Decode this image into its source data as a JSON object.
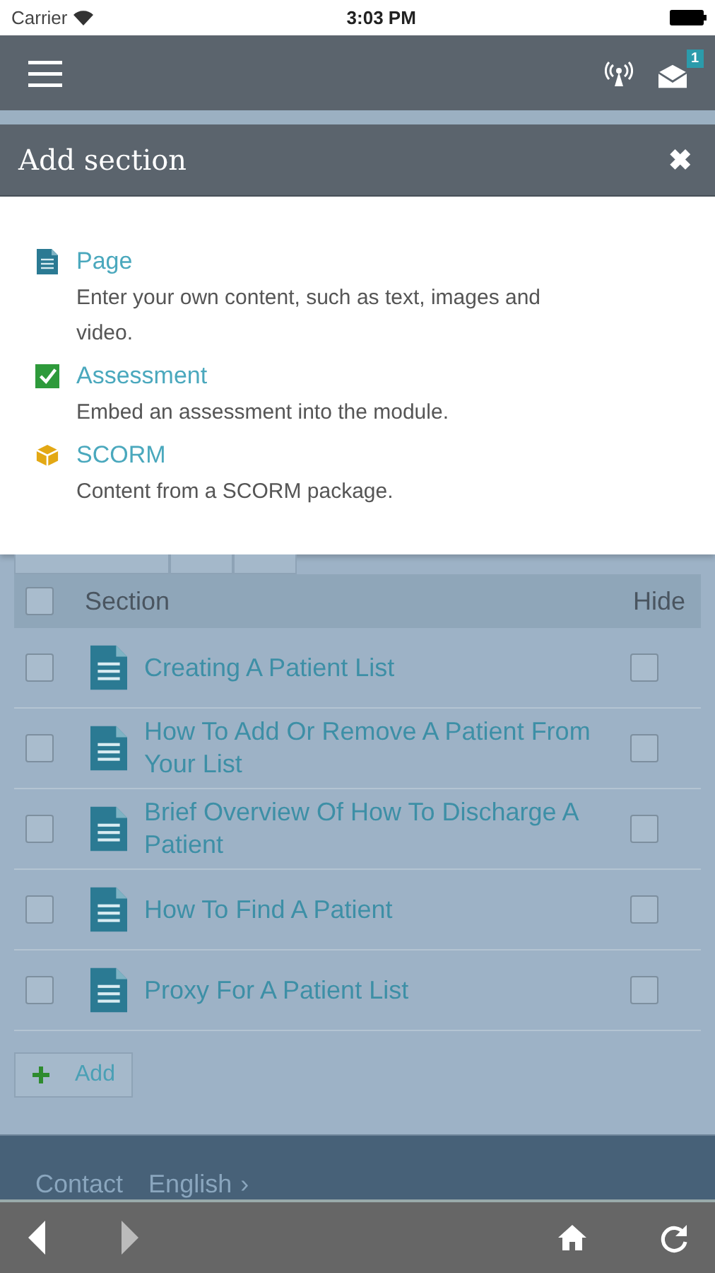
{
  "status_bar": {
    "carrier": "Carrier",
    "time": "3:03 PM"
  },
  "nav": {
    "badge": "1"
  },
  "dialog": {
    "title": "Add section",
    "close": "✖",
    "options": [
      {
        "kind": "page",
        "label": "Page",
        "description": "Enter your own content, such as text, images and video."
      },
      {
        "kind": "assessment",
        "label": "Assessment",
        "description": "Embed an assessment into the module."
      },
      {
        "kind": "scorm",
        "label": "SCORM",
        "description": "Content from a SCORM package."
      }
    ]
  },
  "table": {
    "header_checked": false,
    "columns": [
      "Section",
      "Hide"
    ],
    "rows": [
      {
        "title": "Creating A Patient List",
        "checked": false,
        "hide": false
      },
      {
        "title": "How To Add Or Remove A Patient From Your List",
        "checked": false,
        "hide": false
      },
      {
        "title": "Brief Overview Of How To Discharge A Patient",
        "checked": false,
        "hide": false
      },
      {
        "title": "How To Find A Patient",
        "checked": false,
        "hide": false
      },
      {
        "title": "Proxy For A Patient List",
        "checked": false,
        "hide": false
      }
    ]
  },
  "add_button": "Add",
  "footer": {
    "links": [
      "Contact",
      "English"
    ],
    "chevron": "›"
  }
}
